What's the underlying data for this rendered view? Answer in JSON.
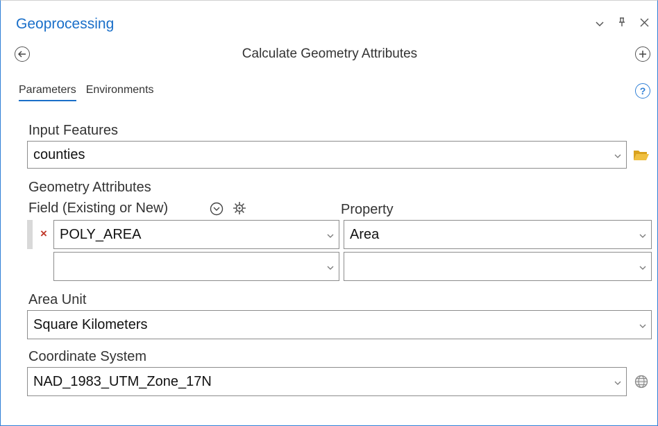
{
  "pane": {
    "title": "Geoprocessing",
    "controls": {
      "dropdown": "⌄",
      "pin": "ᵖ",
      "close": "×"
    }
  },
  "tool": {
    "title": "Calculate Geometry Attributes",
    "back_icon": "back-arrow-icon",
    "add_icon": "add-circle-icon"
  },
  "tabs": [
    {
      "label": "Parameters",
      "active": true
    },
    {
      "label": "Environments",
      "active": false
    }
  ],
  "input_features": {
    "label": "Input Features",
    "value": "counties"
  },
  "geometry_attributes": {
    "label": "Geometry Attributes",
    "field_header": "Field (Existing or New)",
    "property_header": "Property",
    "rows": [
      {
        "field": "POLY_AREA",
        "property": "Area"
      },
      {
        "field": "",
        "property": ""
      }
    ]
  },
  "area_unit": {
    "label": "Area Unit",
    "value": "Square Kilometers"
  },
  "coordinate_system": {
    "label": "Coordinate System",
    "value": "NAD_1983_UTM_Zone_17N"
  },
  "colors": {
    "accent": "#1a6fc9",
    "border": "#8c8c8c",
    "remove": "#c0392b",
    "folder": "#e8b52e"
  }
}
